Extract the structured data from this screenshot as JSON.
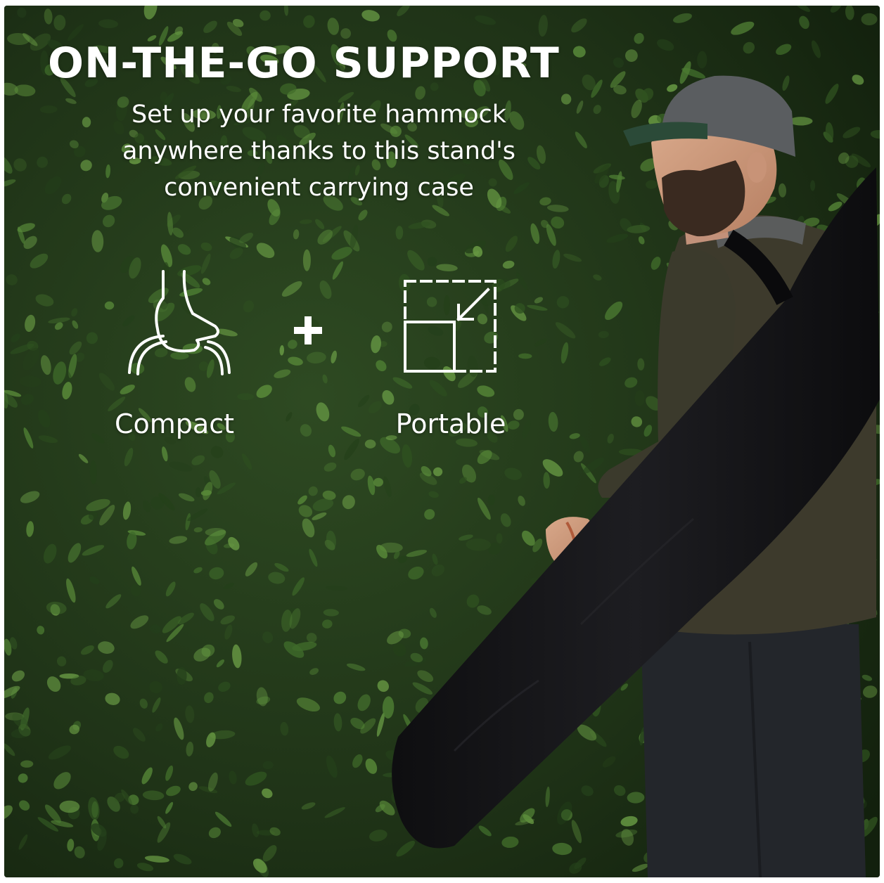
{
  "headline": "ON-THE-GO SUPPORT",
  "description_lines": [
    "Set up your favorite hammock",
    "anywhere thanks to this stand's",
    "convenient carrying case"
  ],
  "features": [
    {
      "label": "Compact",
      "icon": "hand-grip-icon"
    },
    {
      "label": "Portable",
      "icon": "resize-box-icon"
    }
  ],
  "separator_icon": "plus-icon",
  "photo": {
    "subject": "man-carrying-black-bag",
    "background": "green-hedge"
  },
  "colors": {
    "text": "#ffffff",
    "hedge_dark": "#1f3317",
    "hedge_leaf": "#3f6a2a",
    "bag": "#141416",
    "jacket": "#3d3a2c",
    "cap": "#5a5d60",
    "jeans": "#23262b"
  }
}
